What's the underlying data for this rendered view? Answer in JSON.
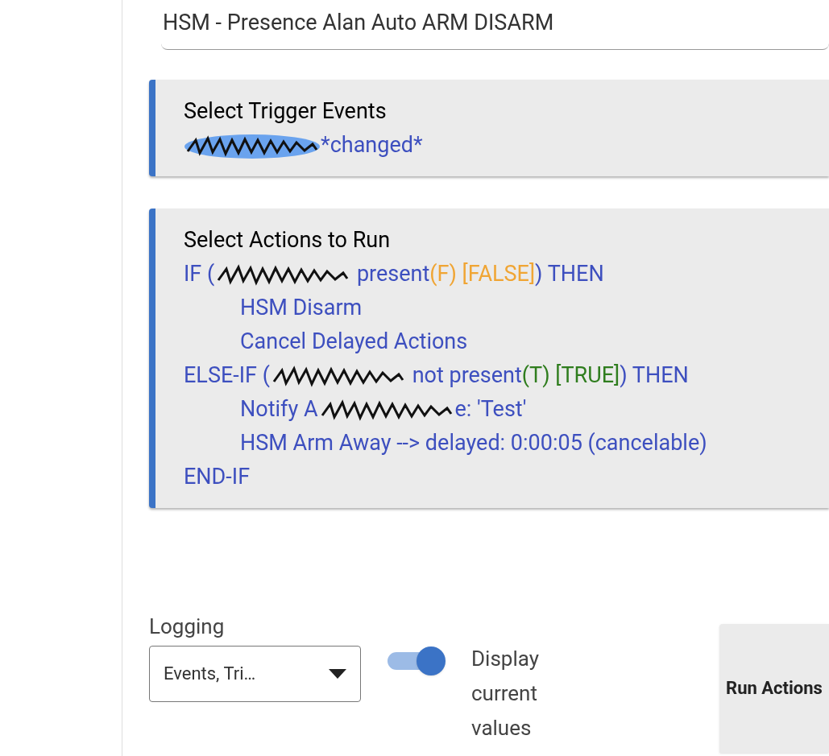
{
  "title_field": {
    "value": "HSM - Presence Alan Auto ARM DISARM"
  },
  "trigger_card": {
    "heading": "Select Trigger Events",
    "lines": [
      {
        "segments": [
          {
            "kind": "redaction"
          },
          {
            "kind": "text",
            "text": "*changed*"
          }
        ]
      }
    ]
  },
  "actions_card": {
    "heading": "Select Actions to Run",
    "lines": [
      {
        "segments": [
          {
            "kind": "text",
            "text": "IF ("
          },
          {
            "kind": "redaction"
          },
          {
            "kind": "text",
            "text": " present"
          },
          {
            "kind": "false",
            "text": "(F) [FALSE]"
          },
          {
            "kind": "text",
            "text": ") THEN"
          }
        ],
        "children": [
          {
            "segments": [
              {
                "kind": "text",
                "text": "HSM Disarm"
              }
            ]
          },
          {
            "segments": [
              {
                "kind": "text",
                "text": "Cancel Delayed Actions"
              }
            ]
          }
        ]
      },
      {
        "segments": [
          {
            "kind": "text",
            "text": "ELSE-IF ("
          },
          {
            "kind": "redaction"
          },
          {
            "kind": "text",
            "text": " not present"
          },
          {
            "kind": "true",
            "text": "(T) [TRUE]"
          },
          {
            "kind": "text",
            "text": ") THEN"
          }
        ],
        "children": [
          {
            "segments": [
              {
                "kind": "text",
                "text": "Notify A"
              },
              {
                "kind": "redaction"
              },
              {
                "kind": "text",
                "text": "e: 'Test'"
              }
            ]
          },
          {
            "segments": [
              {
                "kind": "text",
                "text": "HSM Arm Away --> delayed: 0:00:05 (cancelable)"
              }
            ]
          }
        ]
      },
      {
        "segments": [
          {
            "kind": "text",
            "text": "END-IF"
          }
        ]
      }
    ]
  },
  "logging": {
    "label": "Logging",
    "select_value": "Events, Tri…"
  },
  "display_toggle": {
    "on": true,
    "label": "Display current values"
  },
  "run_button": {
    "label": "Run Actions"
  }
}
